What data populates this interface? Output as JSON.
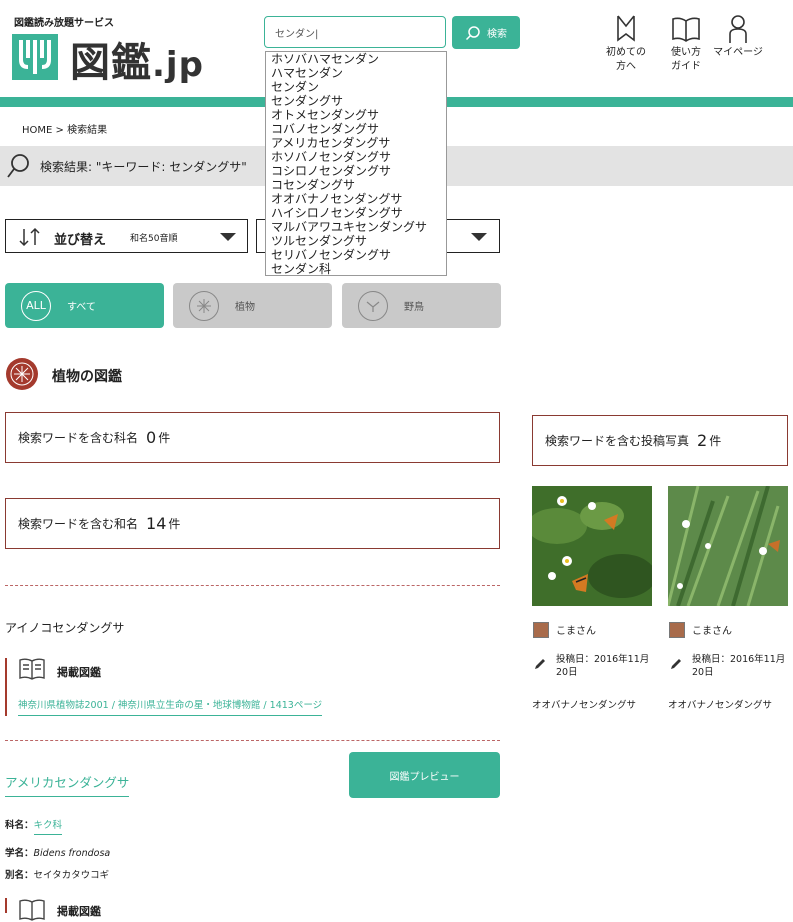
{
  "header": {
    "tagline": "図鑑読み放題サービス",
    "logo_main": "図鑑",
    "logo_suffix": ".jp",
    "search_value": "センダン|",
    "search_button": "検索",
    "nav": [
      {
        "label_line1": "初めての",
        "label_line2": "方へ",
        "icon": "bookmark-icon"
      },
      {
        "label_line1": "使い方",
        "label_line2": "ガイド",
        "icon": "book-icon"
      },
      {
        "label_line1": "マイページ",
        "label_line2": "",
        "icon": "person-icon"
      }
    ]
  },
  "suggestions": [
    "ホソバハマセンダン",
    "ハマセンダン",
    "センダン",
    "センダングサ",
    "オトメセンダングサ",
    "コバノセンダングサ",
    "アメリカセンダングサ",
    "ホソバノセンダングサ",
    "コシロノセンダングサ",
    "コセンダングサ",
    "オオバナノセンダングサ",
    "ハイシロノセンダングサ",
    "マルバアワユキセンダングサ",
    "ツルセンダングサ",
    "セリバノセンダングサ",
    "センダン科"
  ],
  "breadcrumb": {
    "home": "HOME",
    "sep": ">",
    "current": "検索結果"
  },
  "result": {
    "text": "検索結果: \"キーワード: センダングサ\""
  },
  "sort": {
    "label": "並び替え",
    "value": "和名50音順"
  },
  "tabs": {
    "all_circle": "ALL",
    "all": "すべて",
    "plant": "植物",
    "bird": "野鳥"
  },
  "section": {
    "title": "植物の図鑑"
  },
  "counts": {
    "family_label": "検索ワードを含む科名",
    "family_count": "0",
    "family_unit": "件",
    "wamei_label": "検索ワードを含む和名",
    "wamei_count": "14",
    "wamei_unit": "件",
    "photo_label": "検索ワードを含む投稿写真",
    "photo_count": "2",
    "photo_unit": "件"
  },
  "entry1": {
    "name": "アイノコセンダングサ",
    "heading": "掲載図鑑",
    "link": "神奈川県植物誌2001 / 神奈川県立生命の星・地球博物館 / 1413ページ"
  },
  "entry2": {
    "name": "アメリカセンダングサ",
    "preview_button": "図鑑プレビュー",
    "family_label": "科名：",
    "family": "キク科",
    "scientific_label": "学名：",
    "scientific": "Bidens frondosa",
    "alias_label": "別名：",
    "alias": "セイタカタウコギ",
    "heading": "掲載図鑑"
  },
  "photos": [
    {
      "user": "こまさん",
      "date_line1": "投稿日：2016年11月",
      "date_line2": "20日",
      "caption": "オオバナノセンダングサ"
    },
    {
      "user": "こまさん",
      "date_line1": "投稿日：2016年11月",
      "date_line2": "20日",
      "caption": "オオバナノセンダングサ"
    }
  ],
  "colors": {
    "accent": "#3bb397",
    "section": "#a43a2d",
    "grey": "#c9c9c9"
  }
}
